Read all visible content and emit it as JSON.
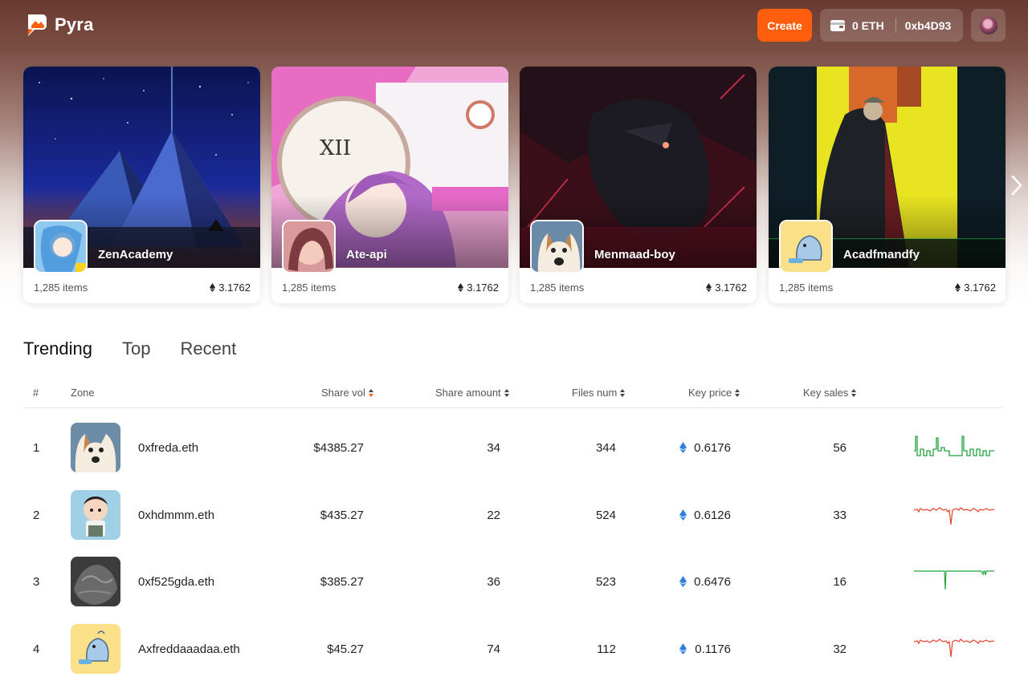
{
  "header": {
    "app_name": "Pyra",
    "create_label": "Create",
    "wallet_balance": "0 ETH",
    "wallet_address": "0xb4D93"
  },
  "featured": [
    {
      "name": "ZenAcademy",
      "items": "1,285 items",
      "price": "3.1762"
    },
    {
      "name": "Ate-api",
      "items": "1,285 items",
      "price": "3.1762"
    },
    {
      "name": "Menmaad-boy",
      "items": "1,285 items",
      "price": "3.1762"
    },
    {
      "name": "Acadfmandfy",
      "items": "1,285 items",
      "price": "3.1762"
    }
  ],
  "tabs": [
    "Trending",
    "Top",
    "Recent"
  ],
  "table": {
    "headers": {
      "rank": "#",
      "zone": "Zone",
      "share_vol": "Share vol",
      "share_amount": "Share amount",
      "files_num": "Files num",
      "key_price": "Key price",
      "key_sales": "Key sales"
    },
    "rows": [
      {
        "rank": "1",
        "zone": "0xfreda.eth",
        "share_vol": "$4385.27",
        "share_amount": "34",
        "files_num": "344",
        "key_price": "0.6176",
        "key_sales": "56",
        "trend_color": "#22a33a"
      },
      {
        "rank": "2",
        "zone": "0xhdmmm.eth",
        "share_vol": "$435.27",
        "share_amount": "22",
        "files_num": "524",
        "key_price": "0.6126",
        "key_sales": "33",
        "trend_color": "#e8412c"
      },
      {
        "rank": "3",
        "zone": "0xf525gda.eth",
        "share_vol": "$385.27",
        "share_amount": "36",
        "files_num": "523",
        "key_price": "0.6476",
        "key_sales": "16",
        "trend_color": "#22a33a"
      },
      {
        "rank": "4",
        "zone": "Axfreddaaadaa.eth",
        "share_vol": "$45.27",
        "share_amount": "74",
        "files_num": "112",
        "key_price": "0.1176",
        "key_sales": "32",
        "trend_color": "#e8412c"
      }
    ]
  },
  "colors": {
    "accent": "#ff5e0e",
    "eth_blue": "#2f7fe0",
    "up": "#22a33a",
    "down": "#e8412c"
  }
}
